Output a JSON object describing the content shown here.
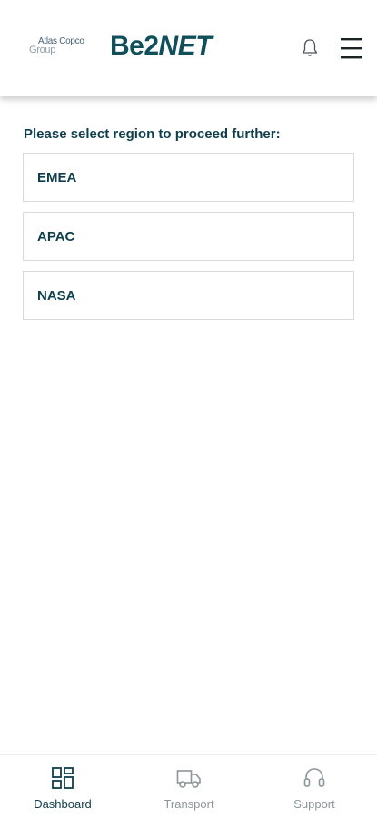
{
  "header": {
    "logo_company": "Atlas Copco",
    "logo_group": "Group",
    "brand_prefix": "Be2",
    "brand_suffix": "NET",
    "bell_icon": "bell-icon",
    "menu_icon": "hamburger-menu-icon"
  },
  "main": {
    "prompt": "Please select region to proceed further:",
    "regions": [
      {
        "label": "EMEA"
      },
      {
        "label": "APAC"
      },
      {
        "label": "NASA"
      }
    ]
  },
  "bottom_nav": {
    "items": [
      {
        "label": "Dashboard",
        "icon": "dashboard-icon",
        "active": true
      },
      {
        "label": "Transport",
        "icon": "truck-icon",
        "active": false
      },
      {
        "label": "Support",
        "icon": "headset-icon",
        "active": false
      }
    ]
  },
  "colors": {
    "brand": "#0f4f5c",
    "text_primary": "#0f3f4c",
    "text_inactive": "#8c9699",
    "border": "#d6dadc"
  }
}
